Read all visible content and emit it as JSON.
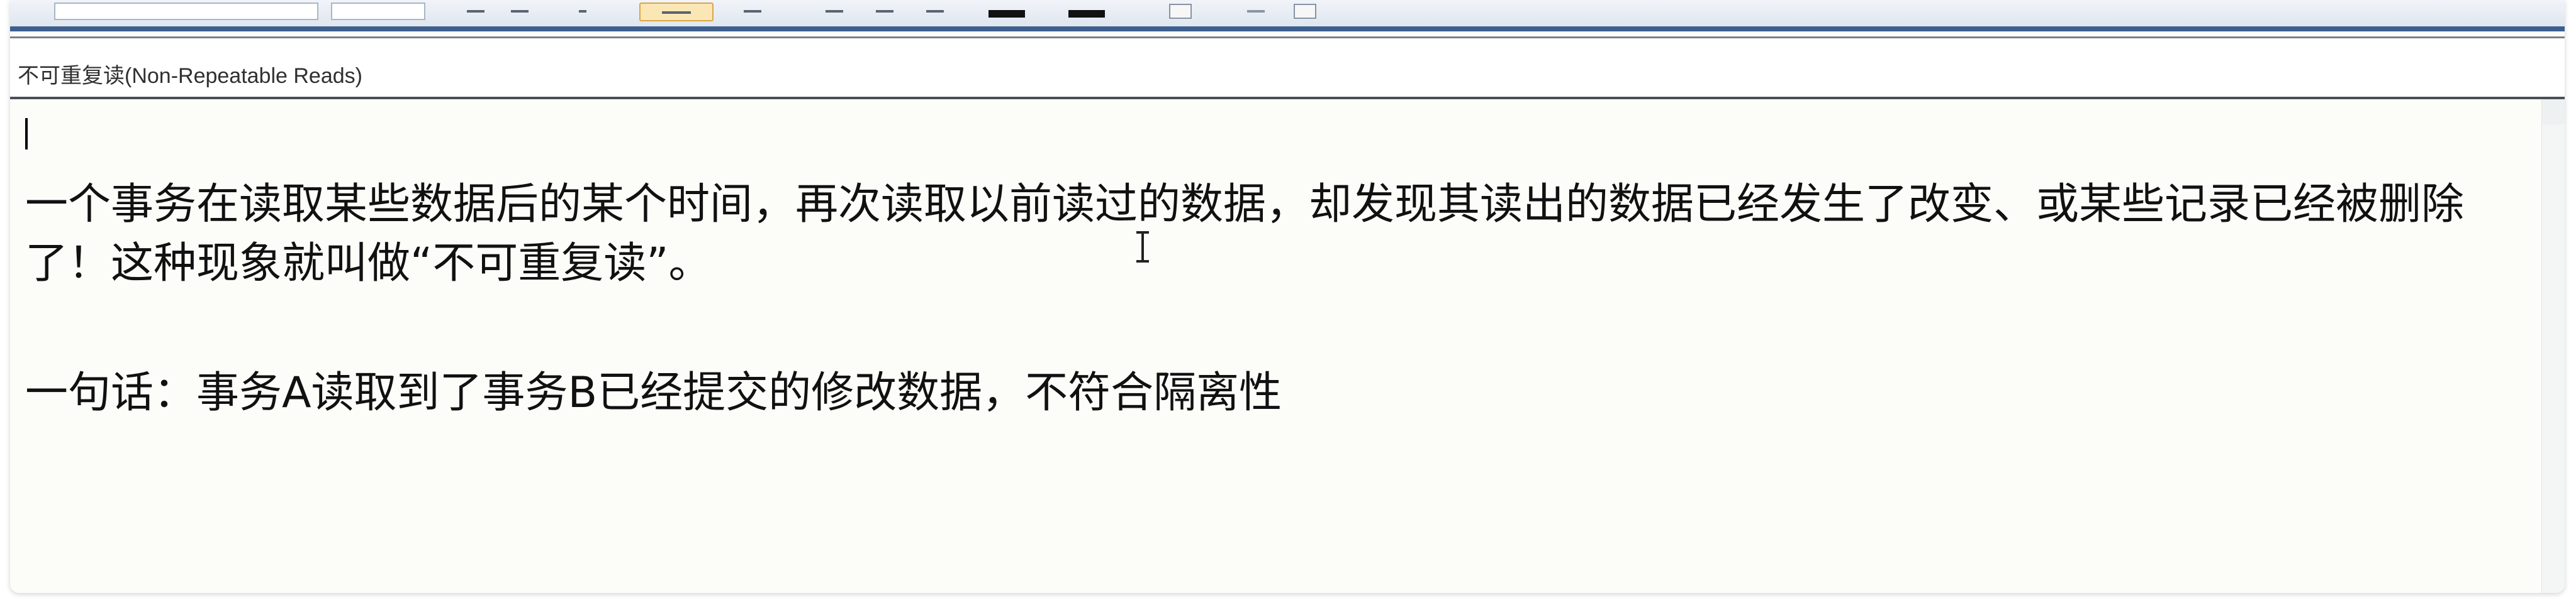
{
  "document": {
    "title": "不可重复读(Non-Repeatable Reads)",
    "paragraph1_line1": "一个事务在读取某些数据后的某个时间，再次读取以前读过的数据，却发现其读出的数据已经发生了改变、或某些记录已经被删除",
    "paragraph1_line2": "了！这种现象就叫做“不可重复读”。",
    "paragraph2": "一句话：事务A读取到了事务B已经提交的修改数据，不符合隔离性"
  },
  "toolbar": {
    "icons": [
      "font-name-field",
      "font-size-field",
      "align-left-icon",
      "align-center-icon",
      "align-right-icon",
      "highlight-icon",
      "indent-icon",
      "list-icon",
      "color-swatch",
      "bg-color-swatch",
      "table-icon",
      "link-icon",
      "image-icon"
    ]
  },
  "colors": {
    "title_bar": "#3e5f8e",
    "text": "#111111",
    "active_button": "#fbe7b6"
  }
}
